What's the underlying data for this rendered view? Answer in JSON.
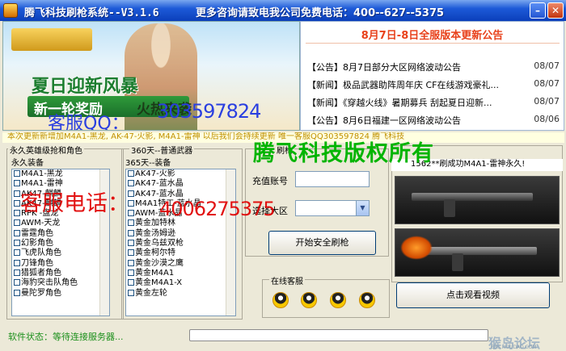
{
  "window": {
    "title": "腾飞科技刷枪系统--V3.1.6",
    "contact": "更多咨询请致电我公司免费电话：400--627--5375",
    "minimize_glyph": "–",
    "close_glyph": "✕"
  },
  "banner": {
    "headline": "夏日迎新风暴",
    "reward": "新一轮奖励",
    "hot": "火热来袭",
    "qq_label": "客服QQ：",
    "qq_number": "303597824"
  },
  "news": {
    "title": "8月7日-8日全服版本更新公告",
    "items": [
      {
        "text": "【公告】8月7日部分大区网络波动公告",
        "date": "08/07"
      },
      {
        "text": "【新闻】极品武器助阵周年庆 CF在线游戏豪礼...",
        "date": "08/07"
      },
      {
        "text": "【新闻】《穿越火线》暑期募兵 刮起夏日迎新...",
        "date": "08/07"
      },
      {
        "text": "【公告】8月6日福建一区网络波动公告",
        "date": "08/06"
      }
    ]
  },
  "update_text": "本次更新新增加M4A1-黑龙, AK-47-火影, M4A1-雷神 以后我们会持续更新 唯一客服QQ303597824    腾飞科技",
  "permanent": {
    "group_label": "永久英雄级抢和角色",
    "list_label": "永久装备",
    "items": [
      "M4A1-黑龙",
      "M4A1-雷神",
      "AK47-麒麟",
      "AK47-麒麟",
      "RPK -盘龙",
      "AWM-天龙",
      "雷霆角色",
      "幻影角色",
      "飞虎队角色",
      "刀锋角色",
      "猎狐者角色",
      "海豹突击队角色",
      "曼陀罗角色"
    ]
  },
  "days365": {
    "group_label": "360天--普通武器",
    "list_label": "365天--装备",
    "items": [
      "AK47-火影",
      "AK47-蓝水晶",
      "AK47-蓝水晶",
      "M4A1特工-蓝水晶",
      "AWM-蓝水晶",
      "黄金加特林",
      "黄金汤姆逊",
      "黄金乌兹双枪",
      "黄金柯尔特",
      "黄金沙漠之鹰",
      "黄金M4A1",
      "黄金M4A1-X",
      "黄金左轮"
    ]
  },
  "form": {
    "group_label": "刷枪",
    "account_label": "充值账号",
    "account_value": "",
    "region_label": "选择大区",
    "region_value": "",
    "start_button": "开始安全刷枪",
    "service_label": "在线客服",
    "qq_icons": 4,
    "video_button": "点击观看视频"
  },
  "gun_strip": "1562**刷成功M4A1-雷神永久!",
  "watermarks": {
    "copyright": "腾飞科技版权所有",
    "phone_label": "客服电话：",
    "phone_number": "4006275375",
    "site_name": "猴岛论坛",
    "site_url": "BBS.HOUDAO.COM"
  },
  "status": {
    "text": "软件状态：等待连接服务器...",
    "progress": 0.0
  },
  "colors": {
    "titlebar": "#1d5ad8",
    "news_title": "#e8411b",
    "watermark_green": "#00b400",
    "watermark_red": "#e00000",
    "status_green": "#1a8f1a",
    "qq_blue": "#2a3fe0"
  }
}
